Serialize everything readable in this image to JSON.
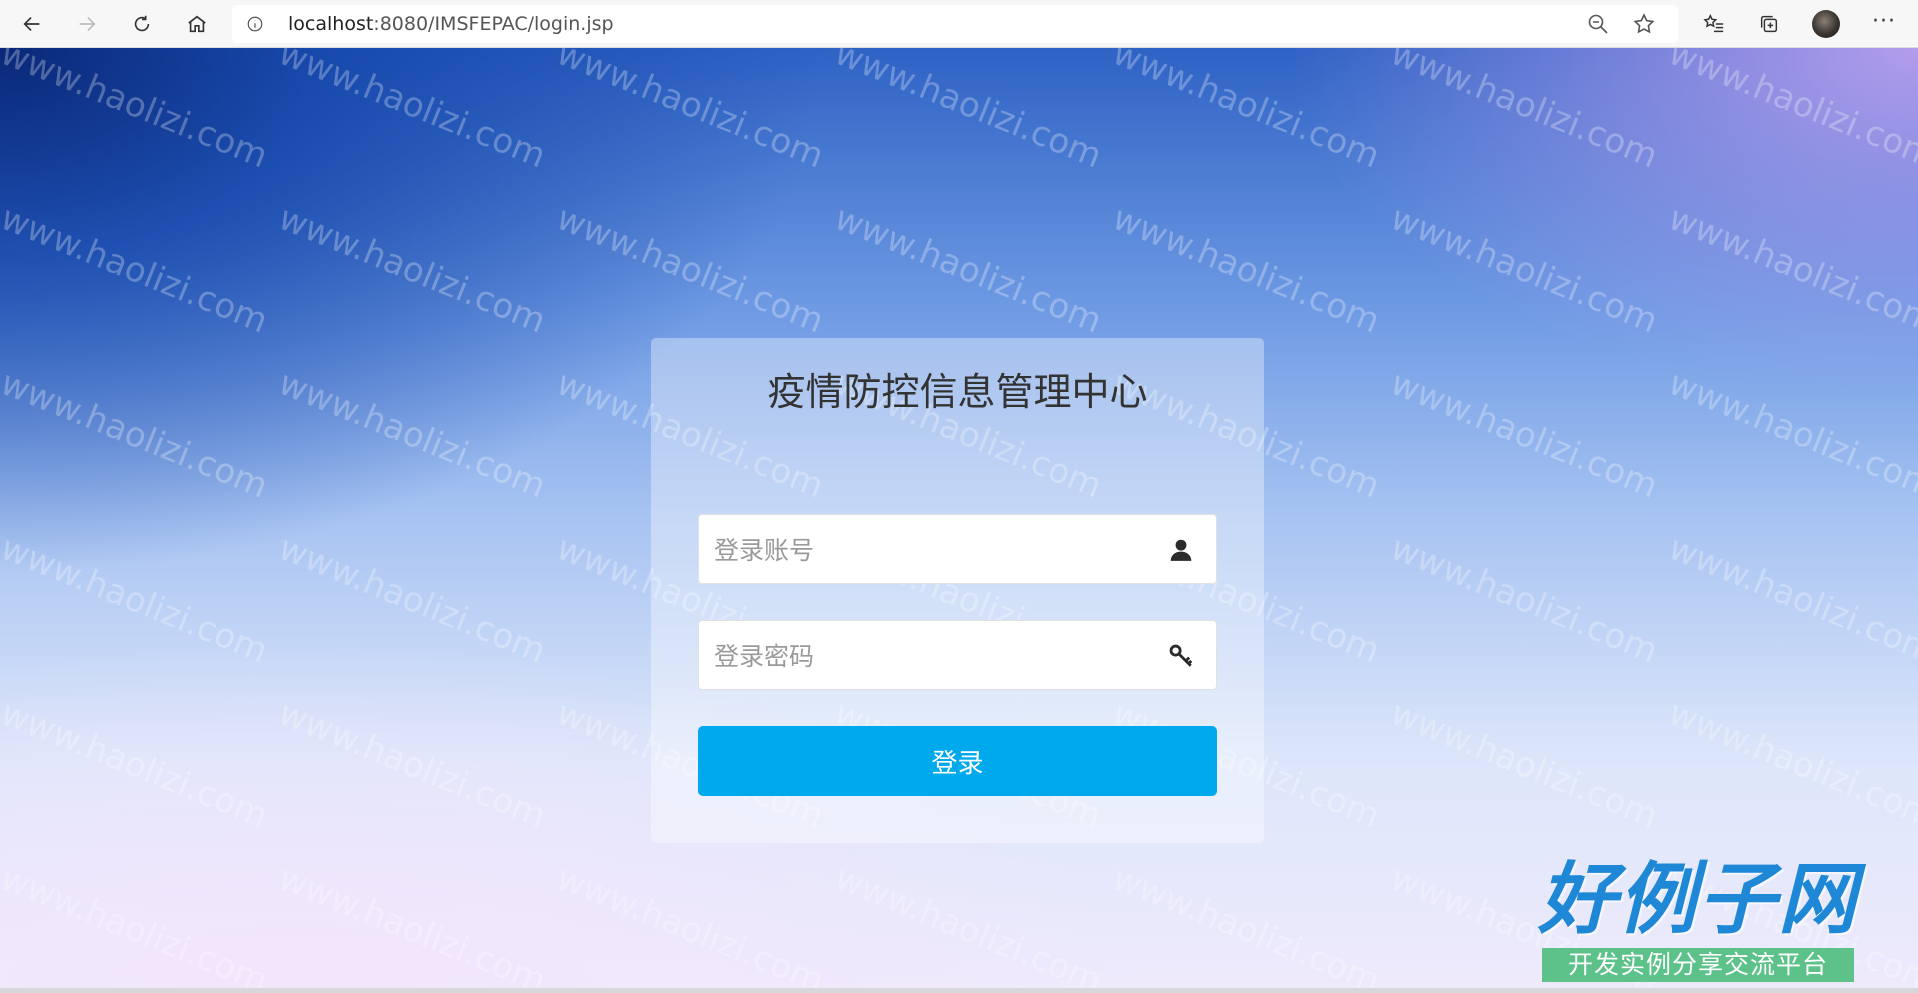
{
  "browser": {
    "url_host": "localhost",
    "url_path": ":8080/IMSFEPAC/login.jsp"
  },
  "login": {
    "title": "疫情防控信息管理中心",
    "username_placeholder": "登录账号",
    "password_placeholder": "登录密码",
    "submit_label": "登录"
  },
  "watermark": {
    "text": "www.haolizi.com"
  },
  "site_logo": {
    "main": "好例子网",
    "sub": "开发实例分享交流平台"
  },
  "colors": {
    "button": "#00a8ec",
    "logo_main": "#1e88d6",
    "logo_sub_bg": "#5cc28a"
  },
  "icons": {
    "back": "arrow-left-icon",
    "forward": "arrow-right-icon",
    "refresh": "refresh-icon",
    "home": "home-icon",
    "info": "info-icon",
    "zoom": "zoom-out-icon",
    "favorite": "star-icon",
    "favorites_bar": "favorites-icon",
    "collections": "collections-icon",
    "more": "more-icon",
    "user": "user-icon",
    "key": "key-icon"
  }
}
